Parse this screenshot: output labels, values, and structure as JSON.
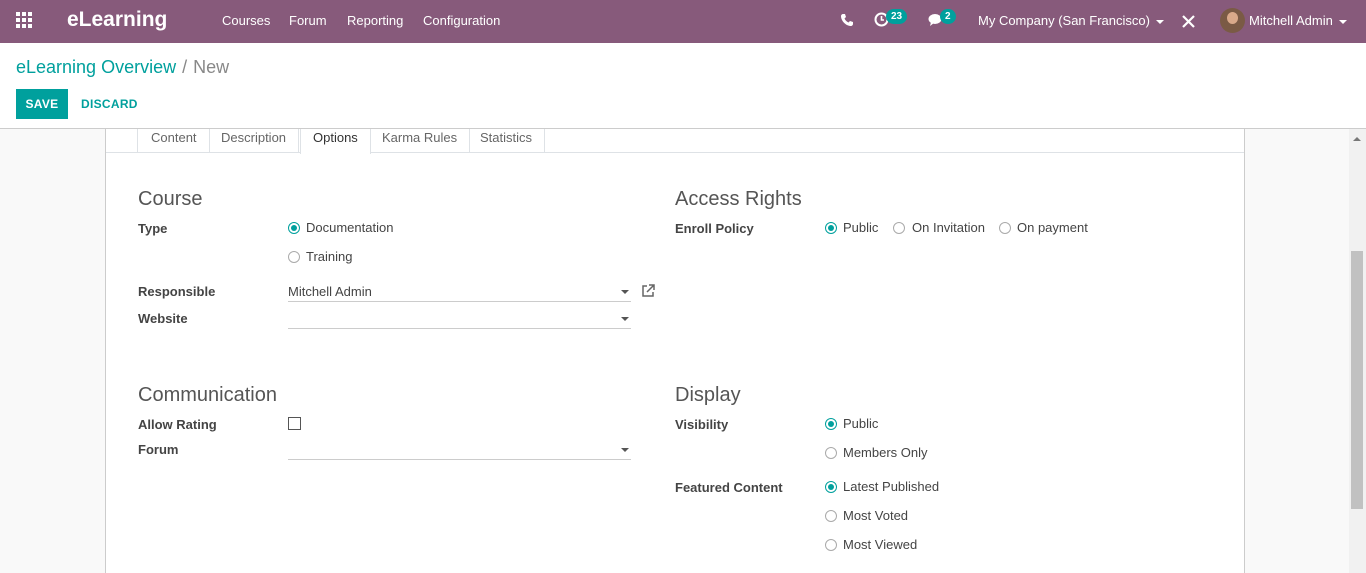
{
  "navbar": {
    "brand": "eLearning",
    "menu": [
      "Courses",
      "Forum",
      "Reporting",
      "Configuration"
    ],
    "activity_count": "23",
    "messages_count": "2",
    "company": "My Company (San Francisco)",
    "user": "Mitchell Admin"
  },
  "breadcrumb": {
    "root": "eLearning Overview",
    "separator": "/",
    "current": "New"
  },
  "actions": {
    "save": "SAVE",
    "discard": "DISCARD"
  },
  "tabs": [
    "Content",
    "Description",
    "Options",
    "Karma Rules",
    "Statistics"
  ],
  "active_tab": "Options",
  "course": {
    "title": "Course",
    "type_label": "Type",
    "type_options": [
      "Documentation",
      "Training"
    ],
    "type_selected": "Documentation",
    "responsible_label": "Responsible",
    "responsible_value": "Mitchell Admin",
    "website_label": "Website",
    "website_value": ""
  },
  "access": {
    "title": "Access Rights",
    "enroll_label": "Enroll Policy",
    "enroll_options": [
      "Public",
      "On Invitation",
      "On payment"
    ],
    "enroll_selected": "Public"
  },
  "communication": {
    "title": "Communication",
    "rating_label": "Allow Rating",
    "rating_checked": false,
    "forum_label": "Forum",
    "forum_value": ""
  },
  "display": {
    "title": "Display",
    "visibility_label": "Visibility",
    "visibility_options": [
      "Public",
      "Members Only"
    ],
    "visibility_selected": "Public",
    "featured_label": "Featured Content",
    "featured_options": [
      "Latest Published",
      "Most Voted",
      "Most Viewed"
    ],
    "featured_selected": "Latest Published"
  },
  "colors": {
    "navbar": "#875a7b",
    "accent": "#00a09d"
  }
}
